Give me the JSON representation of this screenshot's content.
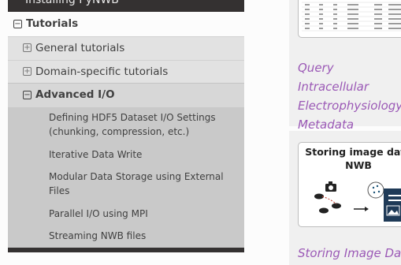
{
  "nav": {
    "top_partial": "Installing PyNWB",
    "tutorials": {
      "label": "Tutorials",
      "toggle": "⊟"
    },
    "general": {
      "label": "General tutorials",
      "toggle": "⊞"
    },
    "domain": {
      "label": "Domain-specific tutorials",
      "toggle": "⊞"
    },
    "advanced": {
      "label": "Advanced I/O",
      "toggle": "⊟"
    },
    "sub_items": [
      "Defining HDF5 Dataset I/O Settings (chunking, compression, etc.)",
      "Iterative Data Write",
      "Modular Data Storage using External Files",
      "Parallel I/O using MPI",
      "Streaming NWB files"
    ]
  },
  "gallery": {
    "card1_caption": "Query Intracellular Electrophysiology Metadata",
    "card2_thumb_title": "Storing image data NWB",
    "card2_caption_partial": "Storing Image Data"
  },
  "colors": {
    "link": "#9b59b6",
    "nav_bg": "#c9c9c9",
    "nav_dark": "#343131"
  }
}
